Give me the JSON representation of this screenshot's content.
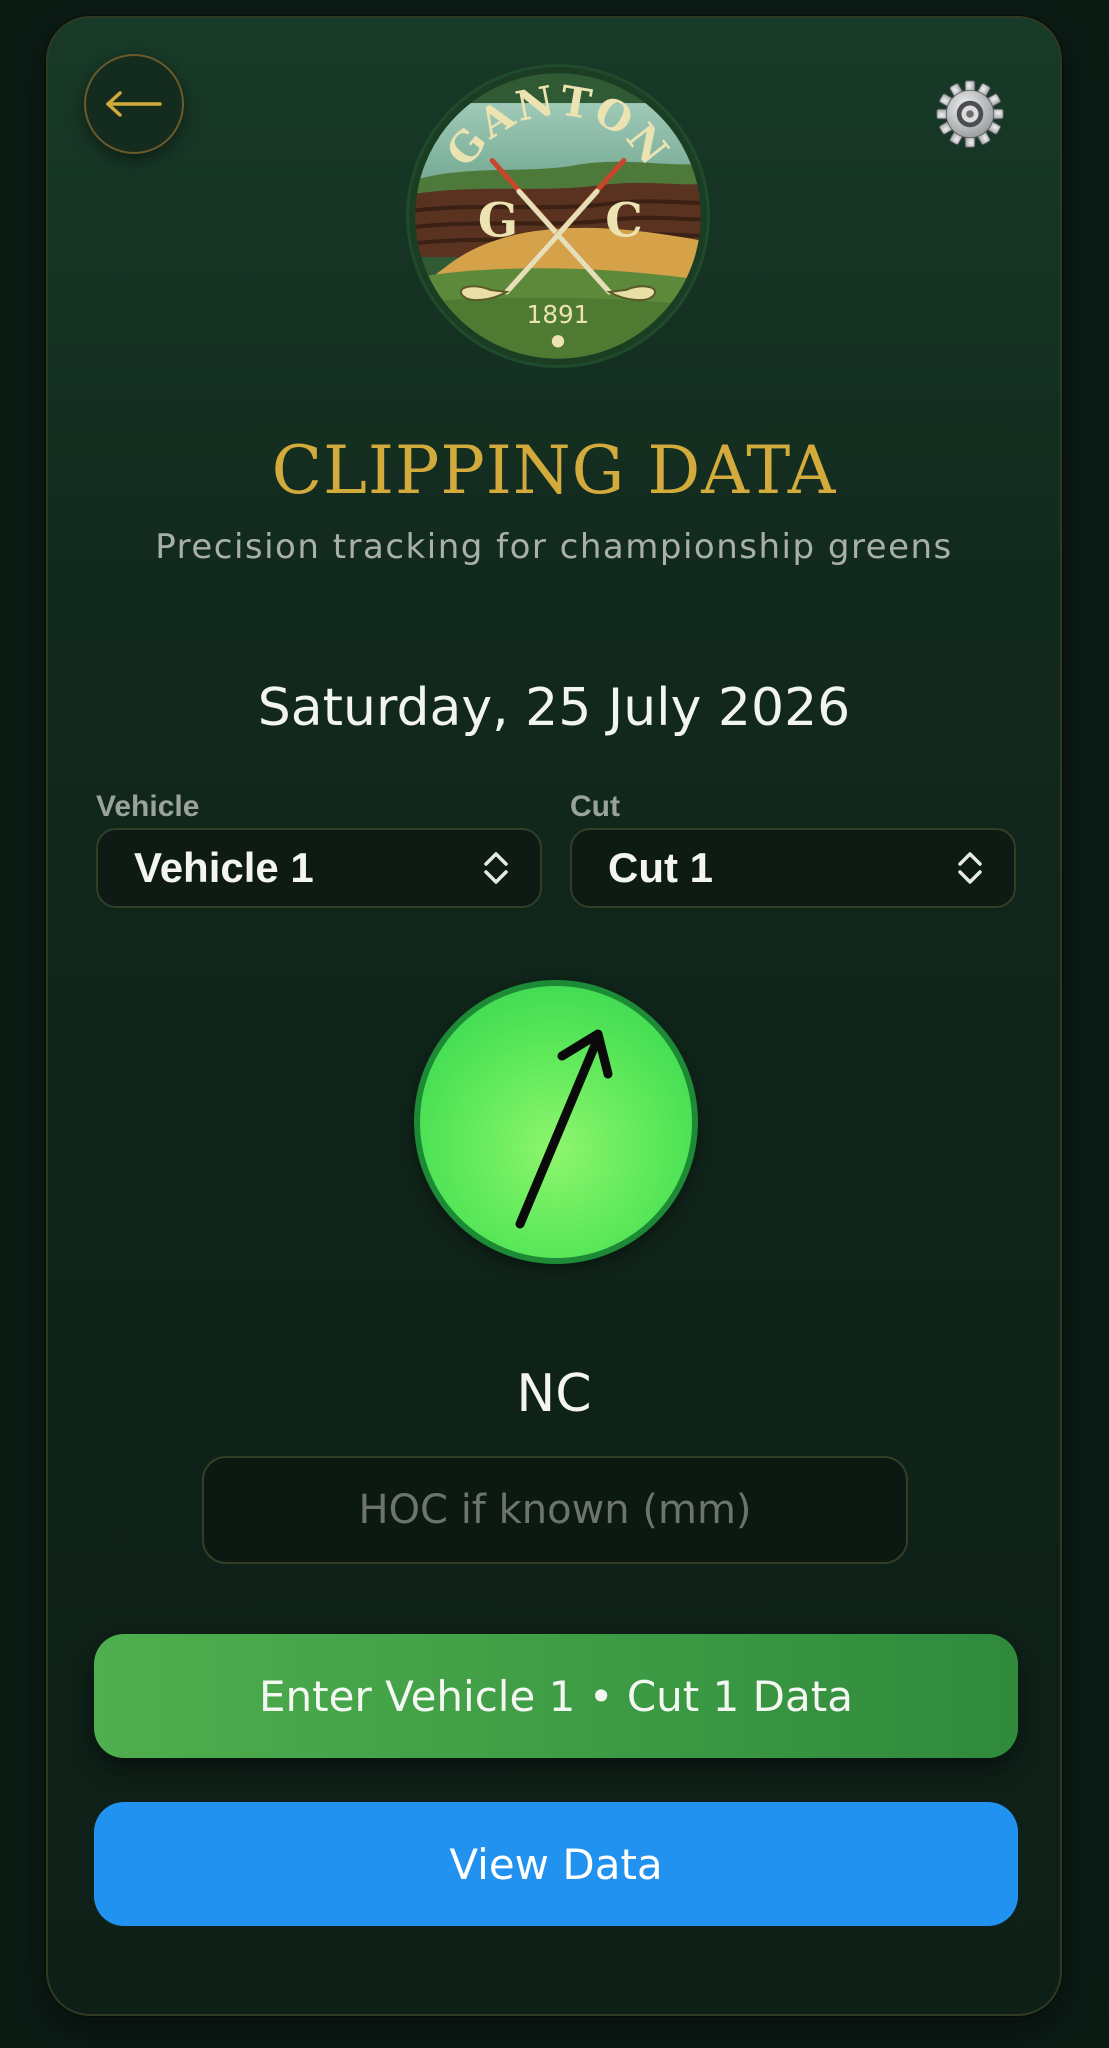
{
  "header": {
    "back_icon": "arrow-left-icon",
    "settings_icon": "gear-icon",
    "logo": {
      "name": "GANTON",
      "letter_left": "G",
      "letter_right": "C",
      "year": "1891"
    }
  },
  "title": "CLIPPING DATA",
  "subtitle": "Precision tracking for championship greens",
  "date": "Saturday, 25 July 2026",
  "vehicle": {
    "label": "Vehicle",
    "value": "Vehicle 1"
  },
  "cut": {
    "label": "Cut",
    "value": "Cut 1"
  },
  "direction_indicator": {
    "icon": "arrow-up-right-icon",
    "reading": "NC"
  },
  "hoc_input": {
    "value": "",
    "placeholder": "HOC if known (mm)"
  },
  "buttons": {
    "enter": "Enter Vehicle 1 • Cut 1 Data",
    "view": "View Data"
  },
  "colors": {
    "accent_gold": "#d2ab3c",
    "enter_green": "#3f9d45",
    "view_blue": "#2192ef",
    "indicator_green": "#5ee95a"
  }
}
